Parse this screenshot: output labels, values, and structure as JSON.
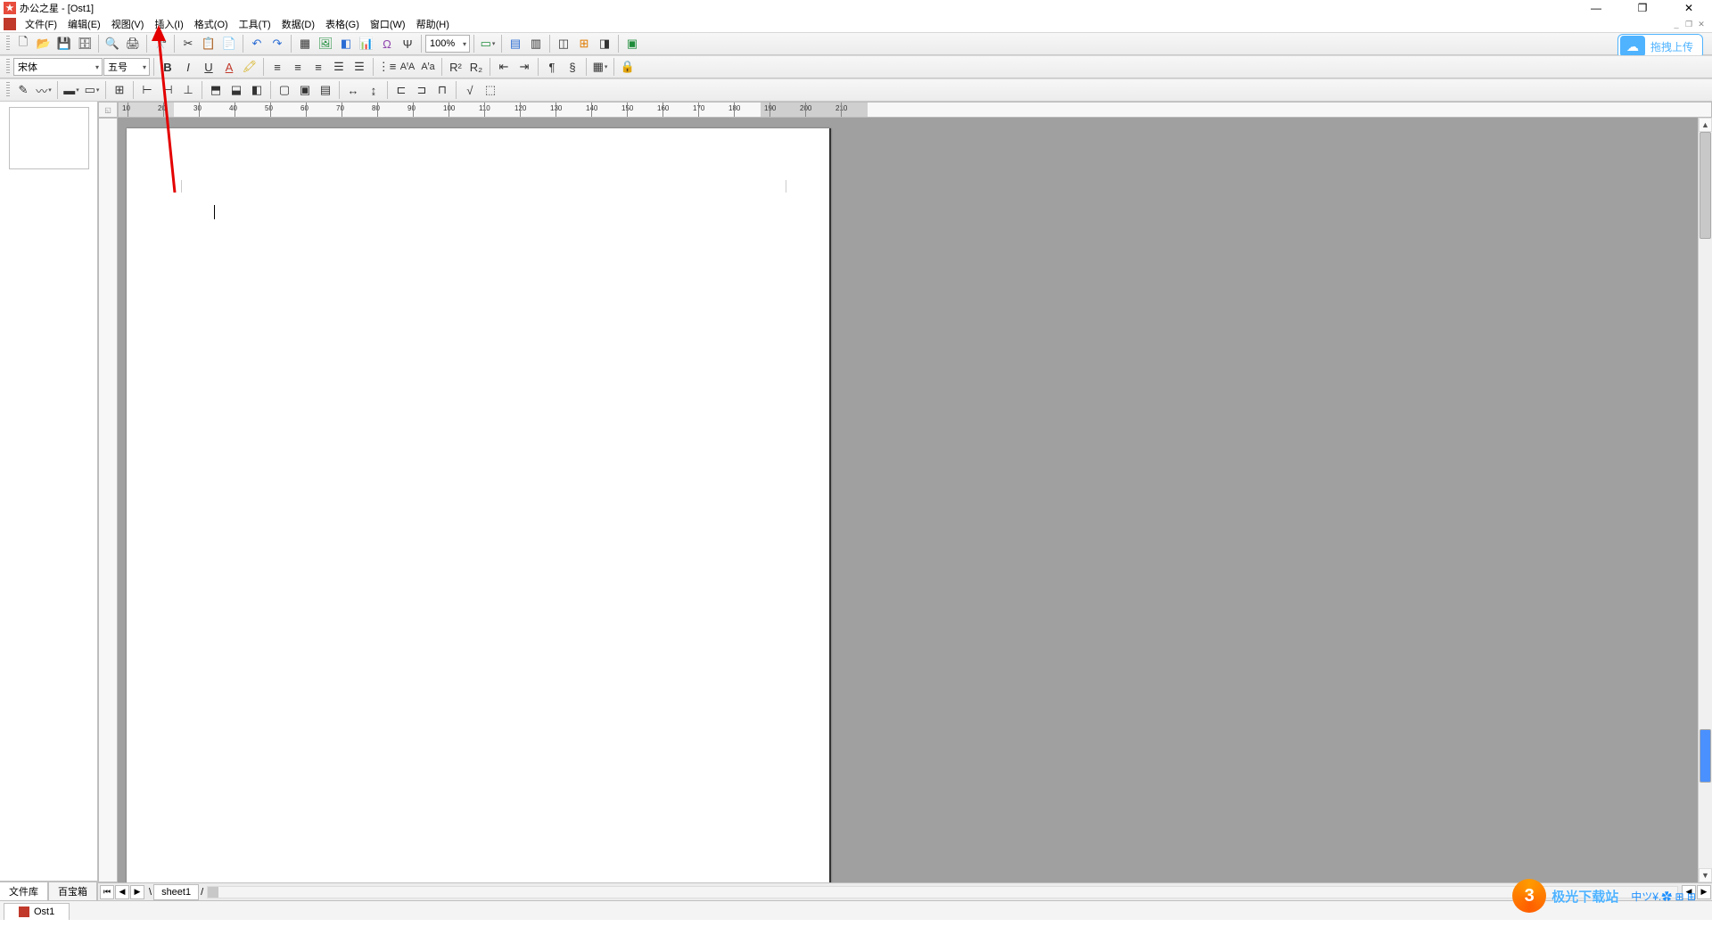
{
  "title": "办公之星 - [Ost1]",
  "menu": [
    "文件(F)",
    "编辑(E)",
    "视图(V)",
    "插入(I)",
    "格式(O)",
    "工具(T)",
    "数据(D)",
    "表格(G)",
    "窗口(W)",
    "帮助(H)"
  ],
  "font": {
    "name": "宋体",
    "size": "五号"
  },
  "zoom": "100%",
  "upload_label": "拖拽上传",
  "left_tabs": [
    "文件库",
    "百宝箱"
  ],
  "sheet_name": "sheet1",
  "doc_tab": "Ost1",
  "ruler_marks": [
    10,
    20,
    30,
    40,
    50,
    60,
    70,
    80,
    90,
    100,
    110,
    120,
    130,
    140,
    150,
    160,
    170,
    180,
    190,
    200,
    210
  ],
  "watermark": {
    "brand": "极光下载站",
    "tray": "中ツ¥.✿ ⊞ ⊞"
  },
  "toolbar1_icons": [
    "new",
    "open",
    "save",
    "save-all",
    "|",
    "preview",
    "print",
    "|",
    "find",
    "|",
    "cut",
    "copy",
    "paste",
    "|",
    "undo",
    "redo",
    "|",
    "table",
    "image",
    "chart-obj",
    "chart",
    "clip",
    "formula",
    "|",
    "zoom-combo",
    "|",
    "slide",
    "|",
    "layout1",
    "layout2",
    "|",
    "win1",
    "win2",
    "win3",
    "|",
    "help"
  ],
  "toolbar2_icons": [
    "font-combo",
    "size-combo",
    "|",
    "bold",
    "italic",
    "underline",
    "font-color",
    "highlight",
    "|",
    "align-left",
    "align-center",
    "align-right",
    "justify",
    "distribute",
    "|",
    "num-list",
    "char-upper",
    "char-lower",
    "|",
    "sup",
    "sub",
    "|",
    "indent-l",
    "indent-r",
    "|",
    "para1",
    "para2",
    "|",
    "border-btn",
    "|",
    "lock"
  ],
  "toolbar3_icons": [
    "pen",
    "brush",
    "|",
    "fill-color",
    "border-color",
    "|",
    "group1",
    "|",
    "snap1",
    "snap2",
    "snap3",
    "|",
    "align-t1",
    "align-t2",
    "align-t3",
    "|",
    "layout-a",
    "layout-b",
    "layout-c",
    "|",
    "dist-h",
    "dist-v",
    "|",
    "arr1",
    "arr2",
    "arr3",
    "|",
    "root",
    "sel"
  ]
}
